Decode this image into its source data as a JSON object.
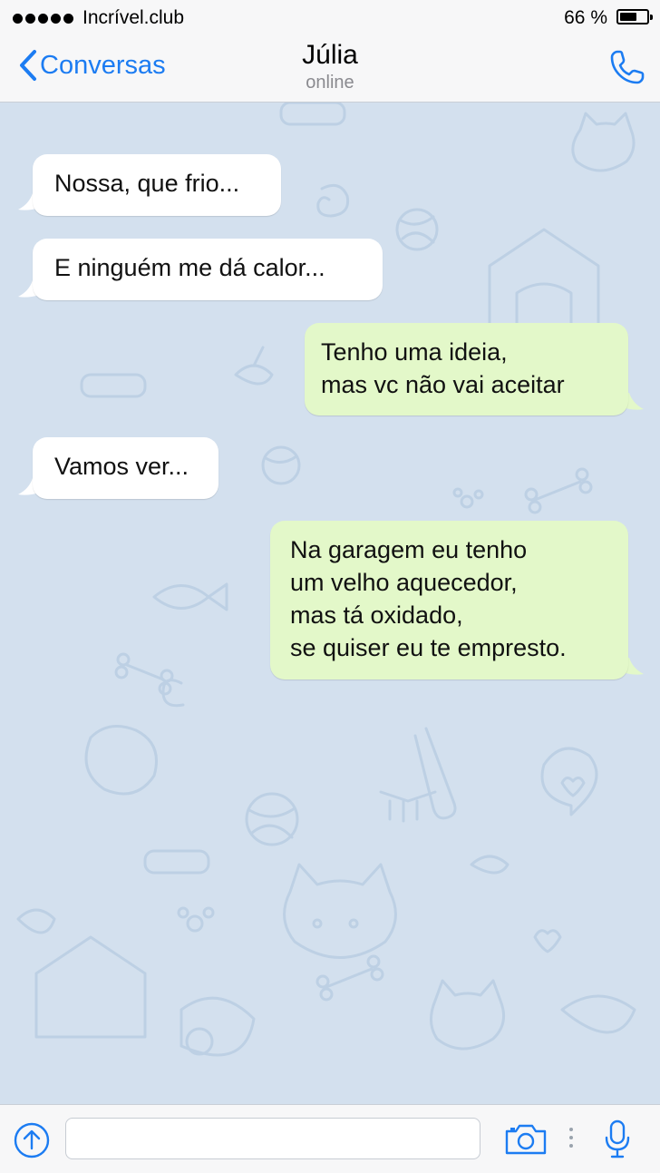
{
  "status_bar": {
    "carrier": "Incrível.club",
    "battery_text": "66 %",
    "battery_level": 0.66,
    "signal_bars": 5
  },
  "nav": {
    "back_label": "Conversas",
    "contact_name": "Júlia",
    "contact_status": "online",
    "accent_color": "#1c7cf2"
  },
  "messages": [
    {
      "direction": "incoming",
      "lines": [
        "Nossa, que frio..."
      ]
    },
    {
      "direction": "incoming",
      "lines": [
        "E ninguém me dá calor..."
      ]
    },
    {
      "direction": "outgoing",
      "lines": [
        "Tenho uma ideia,",
        "mas vc não vai aceitar"
      ]
    },
    {
      "direction": "incoming",
      "lines": [
        "Vamos ver..."
      ]
    },
    {
      "direction": "outgoing",
      "lines": [
        "Na garagem eu tenho",
        "um velho aquecedor,",
        "mas tá oxidado,",
        "se quiser eu te empresto."
      ]
    }
  ],
  "input_bar": {
    "placeholder": "",
    "icons": [
      "attach-icon",
      "camera-icon",
      "microphone-icon"
    ]
  },
  "colors": {
    "chat_background": "#d3e0ee",
    "incoming_bubble": "#ffffff",
    "outgoing_bubble": "#e3f8c9"
  }
}
